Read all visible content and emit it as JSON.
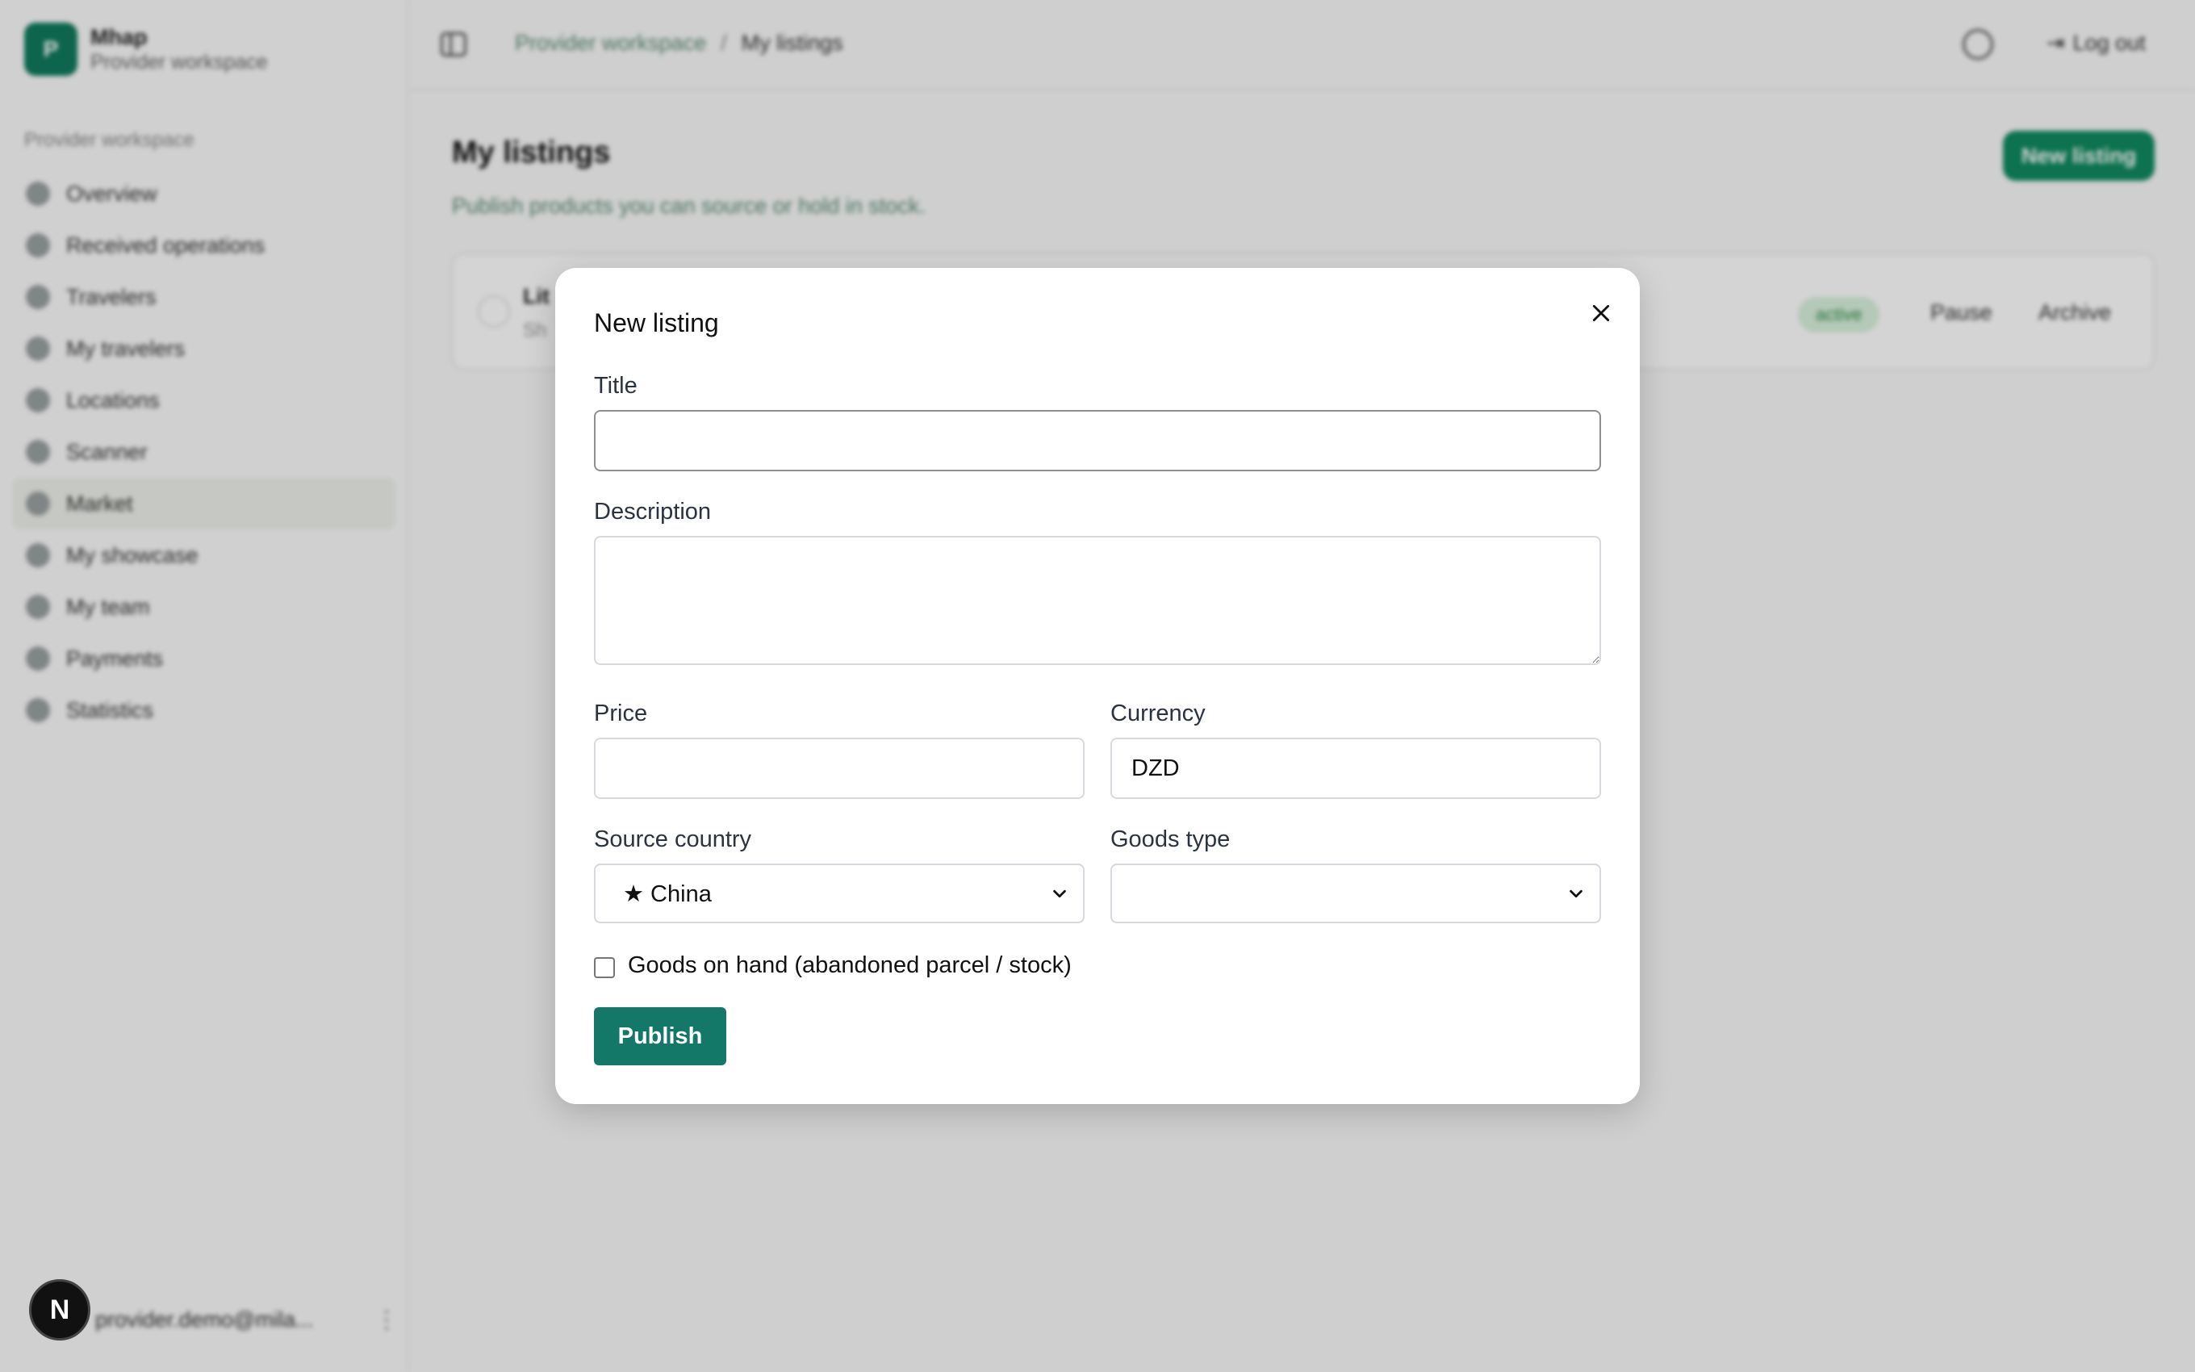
{
  "sidebar": {
    "brand_initial": "P",
    "brand_name": "Mhap",
    "brand_sub": "Provider workspace",
    "section_label": "Provider workspace",
    "items": [
      {
        "label": "Overview",
        "icon": "overview-icon"
      },
      {
        "label": "Received operations",
        "icon": "operations-icon"
      },
      {
        "label": "Travelers",
        "icon": "travelers-icon"
      },
      {
        "label": "My travelers",
        "icon": "my-travelers-icon"
      },
      {
        "label": "Locations",
        "icon": "location-pin-icon"
      },
      {
        "label": "Scanner",
        "icon": "scanner-icon"
      },
      {
        "label": "Market",
        "icon": "market-icon"
      },
      {
        "label": "My showcase",
        "icon": "showcase-icon"
      },
      {
        "label": "My team",
        "icon": "team-icon"
      },
      {
        "label": "Payments",
        "icon": "payments-icon"
      },
      {
        "label": "Statistics",
        "icon": "statistics-icon"
      }
    ],
    "active_item": "Market",
    "footer_email": "provider.demo@mila...",
    "footer_more": "⋮"
  },
  "dev_badge": "N",
  "topbar": {
    "breadcrumb": [
      "Provider workspace",
      "My listings"
    ],
    "breadcrumb_sep": "/",
    "logout_label": "Log out",
    "logout_icon": "⇥"
  },
  "main": {
    "title": "My listings",
    "subtitle": "Publish products you can source or hold in stock.",
    "new_listing_label": "New listing",
    "listing": {
      "title": "Lit",
      "meta": "Sh",
      "status": "active",
      "pause_label": "Pause",
      "archive_label": "Archive"
    }
  },
  "modal": {
    "title": "New listing",
    "title_label": "Title",
    "title_value": "",
    "description_label": "Description",
    "description_value": "",
    "price_label": "Price",
    "price_value": "",
    "currency_label": "Currency",
    "currency_value": "DZD",
    "source_country_label": "Source country",
    "source_country_value": "★ China",
    "goods_type_label": "Goods type",
    "goods_type_value": "",
    "goods_on_hand_label": "Goods on hand (abandoned parcel / stock)",
    "goods_on_hand_checked": false,
    "publish_label": "Publish"
  },
  "colors": {
    "accent": "#137868",
    "brand": "#0f7a5c",
    "overlay": "rgba(0,0,0,0.17)"
  }
}
